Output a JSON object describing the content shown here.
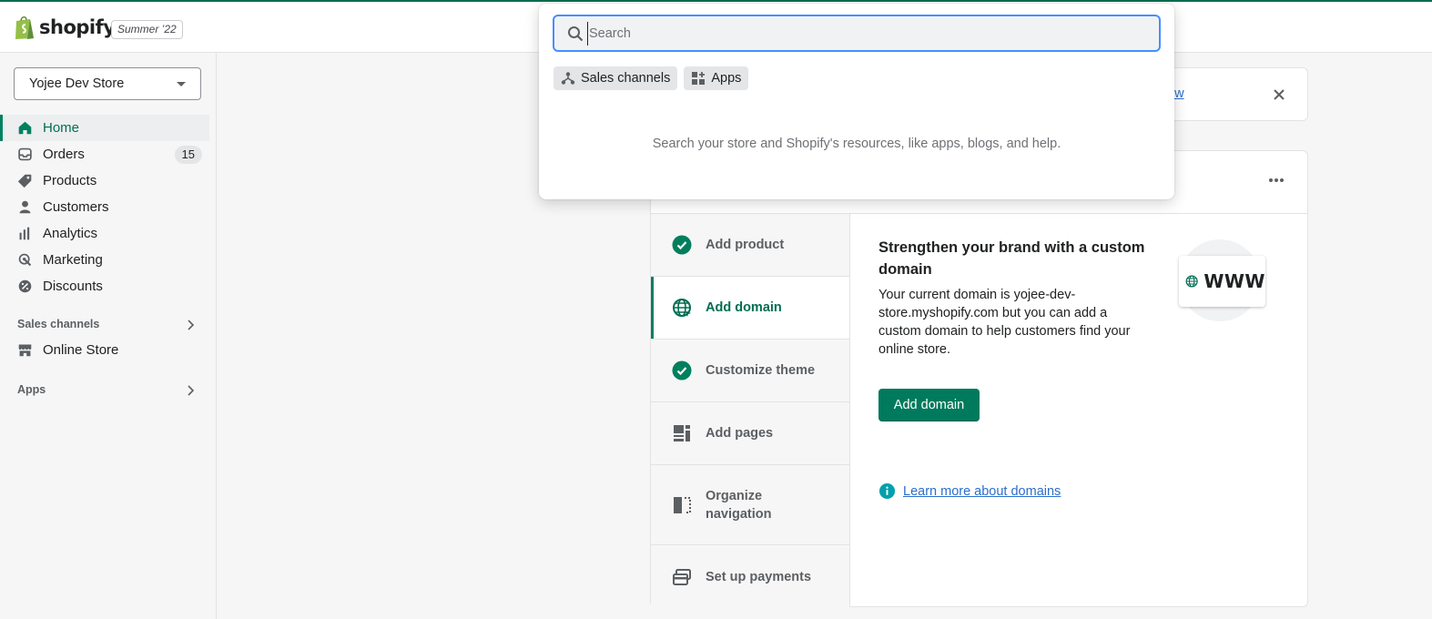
{
  "topbar": {
    "brand": "shopify",
    "edition_badge": "Summer ’22"
  },
  "sidebar": {
    "store_name": "Yojee Dev Store",
    "items": [
      {
        "label": "Home",
        "icon": "home-icon",
        "active": true
      },
      {
        "label": "Orders",
        "icon": "orders-icon",
        "badge": "15"
      },
      {
        "label": "Products",
        "icon": "tag-icon"
      },
      {
        "label": "Customers",
        "icon": "person-icon"
      },
      {
        "label": "Analytics",
        "icon": "analytics-icon"
      },
      {
        "label": "Marketing",
        "icon": "marketing-icon"
      },
      {
        "label": "Discounts",
        "icon": "discount-icon"
      }
    ],
    "sales_channels_heading": "Sales channels",
    "online_store_label": "Online Store",
    "apps_heading": "Apps"
  },
  "banner": {
    "link_text": "ew"
  },
  "setup_card": {
    "steps": [
      {
        "label": "Add product",
        "icon": "check-circle-icon",
        "done": true
      },
      {
        "label": "Add domain",
        "icon": "globe-icon",
        "active": true
      },
      {
        "label": "Customize theme",
        "icon": "check-circle-icon",
        "done": true
      },
      {
        "label": "Add pages",
        "icon": "pages-icon"
      },
      {
        "label": "Organize navigation",
        "icon": "navigation-icon"
      },
      {
        "label": "Set up payments",
        "icon": "payments-icon"
      }
    ],
    "detail_title": "Strengthen your brand with a custom domain",
    "detail_body": "Your current domain is yojee-dev-store.myshopify.com but you can add a custom domain to help customers find your online store.",
    "primary_button": "Add domain",
    "learn_more_link": "Learn more about domains",
    "illustration_text": "WWW"
  },
  "search_popover": {
    "placeholder": "Search",
    "value": "",
    "chips": [
      {
        "label": "Sales channels",
        "icon": "sales-channels-icon"
      },
      {
        "label": "Apps",
        "icon": "apps-icon"
      }
    ],
    "hint": "Search your store and Shopify's resources, like apps, blogs, and help."
  },
  "colors": {
    "accent": "#008060",
    "primary_button": "#007a5c",
    "link": "#2c6ecb",
    "focus_ring": "#458fff"
  }
}
